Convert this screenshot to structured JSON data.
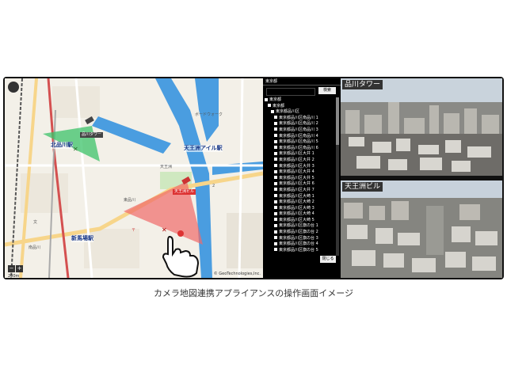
{
  "map": {
    "labels": {
      "kitashinagawa": "北品川駅",
      "shinbamba": "新馬場駅",
      "tennozu_isle": "天王洲アイル駅",
      "tennozu_area": "天王洲",
      "higashishinagawa": "東品川",
      "bunka": "文",
      "police": "〒",
      "park_boardwalk": "ボードウォーク",
      "minami_shinagawa": "南品川",
      "area_number": "2"
    },
    "camera_tags": {
      "cam_shinagawa_tower": "品川タワー",
      "cam_tennozu_building": "天王洲ビル"
    },
    "scale": "200m",
    "copyright": "© GeoTechnologies,Inc."
  },
  "tree": {
    "header": "東京都",
    "search_button": "検索",
    "close_button": "閉じる",
    "items": [
      "東京都",
      "東京都",
      "東京都品川区",
      "東京都品川区南品川 1",
      "東京都品川区南品川 2",
      "東京都品川区南品川 3",
      "東京都品川区南品川 4",
      "東京都品川区南品川 5",
      "東京都品川区南品川 6",
      "東京都品川区大井 1",
      "東京都品川区大井 2",
      "東京都品川区大井 3",
      "東京都品川区大井 4",
      "東京都品川区大井 5",
      "東京都品川区大井 6",
      "東京都品川区大井 7",
      "東京都品川区大崎 1",
      "東京都品川区大崎 2",
      "東京都品川区大崎 3",
      "東京都品川区大崎 4",
      "東京都品川区大崎 5",
      "東京都品川区旗の台 1",
      "東京都品川区旗の台 2",
      "東京都品川区旗の台 3",
      "東京都品川区旗の台 4",
      "東京都品川区旗の台 5"
    ]
  },
  "cameras": [
    {
      "label": "品川タワー"
    },
    {
      "label": "天王洲ビル"
    }
  ],
  "caption": "カメラ地図連携アプライアンスの操作画面イメージ",
  "colors": {
    "river": "#4a9de0",
    "road_major": "#f7d58a",
    "fov_green": "#3cc36a",
    "fov_red": "#f06a6a",
    "rail": "#d45050"
  }
}
